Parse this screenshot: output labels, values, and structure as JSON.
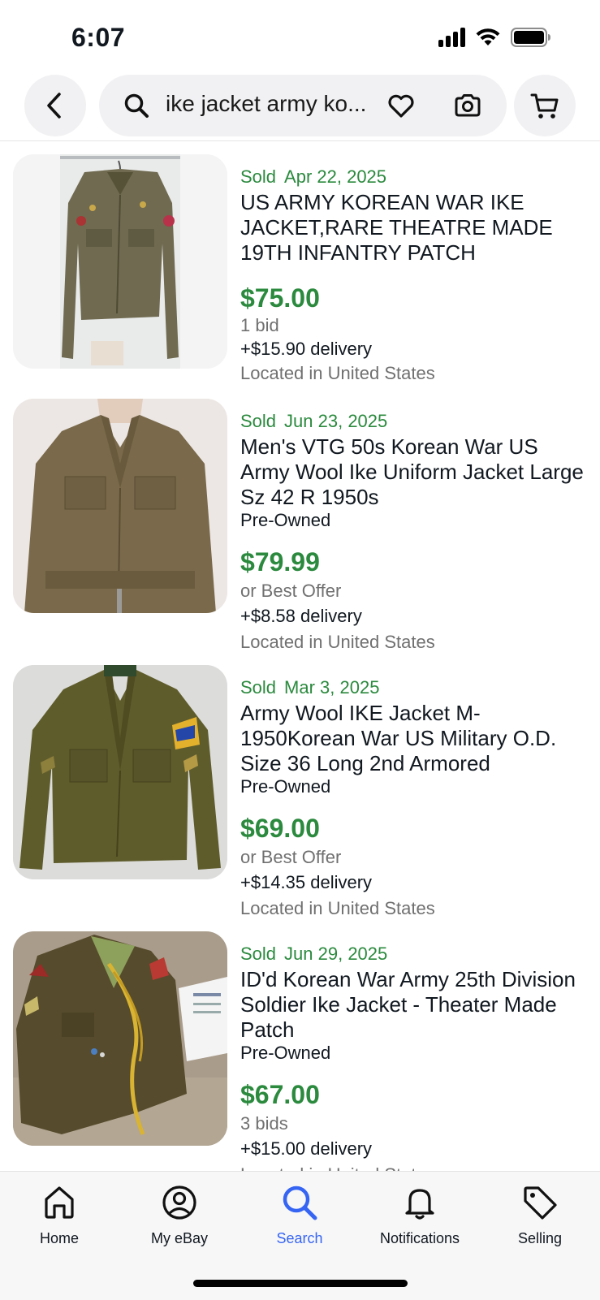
{
  "status_bar": {
    "time": "6:07"
  },
  "header": {
    "search_query": "ike jacket army ko..."
  },
  "listings": [
    {
      "sold_label": "Sold",
      "sold_date": "Apr 22, 2025",
      "title": "US ARMY KOREAN WAR IKE JACKET,RARE THEATRE MADE 19TH INFANTRY PATCH",
      "condition": "",
      "price": "$75.00",
      "purchase_note": "1 bid",
      "delivery": "+$15.90 delivery",
      "location": "Located in United States"
    },
    {
      "sold_label": "Sold",
      "sold_date": "Jun 23, 2025",
      "title": "Men's VTG 50s Korean War US Army Wool Ike Uniform Jacket Large Sz 42 R 1950s",
      "condition": "Pre-Owned",
      "price": "$79.99",
      "purchase_note": "or Best Offer",
      "delivery": "+$8.58 delivery",
      "location": "Located in United States"
    },
    {
      "sold_label": "Sold",
      "sold_date": "Mar 3, 2025",
      "title": "Army Wool IKE Jacket M-1950Korean War US Military O.D.  Size 36 Long 2nd Armored",
      "condition": "Pre-Owned",
      "price": "$69.00",
      "purchase_note": "or Best Offer",
      "delivery": "+$14.35 delivery",
      "location": "Located in United States"
    },
    {
      "sold_label": "Sold",
      "sold_date": "Jun 29, 2025",
      "title": "ID'd Korean War Army 25th Division Soldier Ike Jacket - Theater Made Patch",
      "condition": "Pre-Owned",
      "price": "$67.00",
      "purchase_note": "3 bids",
      "delivery": "+$15.00 delivery",
      "location": "Located in United States"
    }
  ],
  "bottom_nav": {
    "home": "Home",
    "my_ebay": "My eBay",
    "search": "Search",
    "notifications": "Notifications",
    "selling": "Selling"
  },
  "colors": {
    "sold_green": "#2b8a3e",
    "active_blue": "#3665f3",
    "muted_gray": "#707070",
    "pill_bg": "#f1f1f3"
  }
}
